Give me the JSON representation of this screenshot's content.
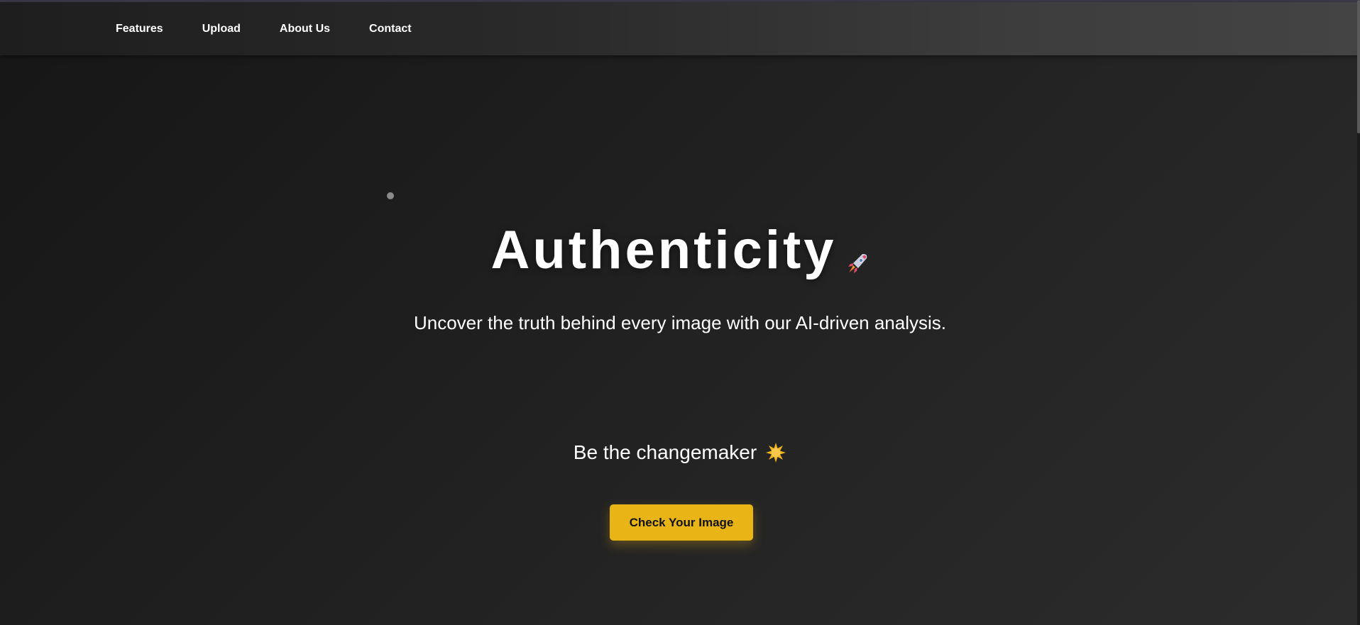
{
  "nav": {
    "items": [
      {
        "label": "Features"
      },
      {
        "label": "Upload"
      },
      {
        "label": "About Us"
      },
      {
        "label": "Contact"
      }
    ]
  },
  "hero": {
    "title": "Authenticity",
    "title_icon": "rocket-icon",
    "subtitle": "Uncover the truth behind every image with our AI-driven analysis.",
    "tagline": "Be the changemaker",
    "tagline_icon": "sparkle-icon",
    "cta_label": "Check Your Image"
  },
  "colors": {
    "accent": "#e9b416",
    "text": "#ffffff",
    "background": "#1f1f1f"
  }
}
